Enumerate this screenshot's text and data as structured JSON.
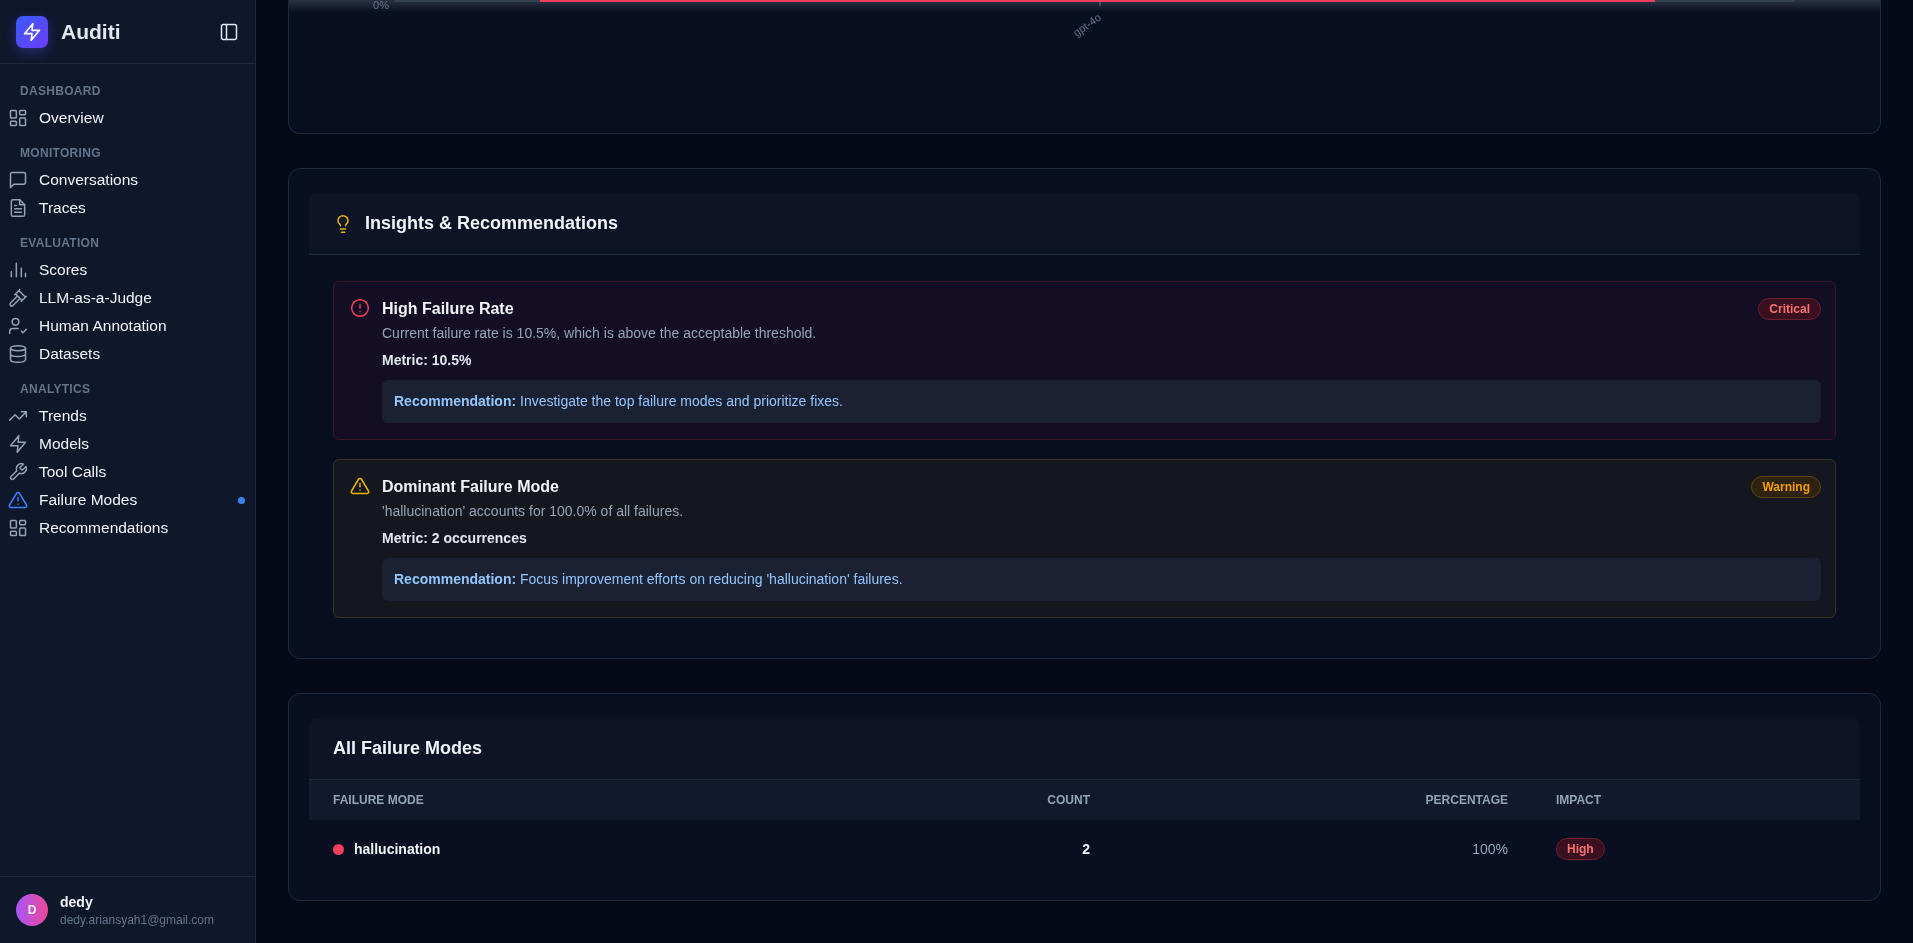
{
  "sidebar": {
    "brand": "Auditi",
    "sections": [
      {
        "label": "DASHBOARD",
        "items": [
          {
            "label": "Overview",
            "selected": false
          }
        ]
      },
      {
        "label": "MONITORING",
        "items": [
          {
            "label": "Conversations",
            "selected": false
          },
          {
            "label": "Traces",
            "selected": false
          }
        ]
      },
      {
        "label": "EVALUATION",
        "items": [
          {
            "label": "Scores",
            "selected": false
          },
          {
            "label": "LLM-as-a-Judge",
            "selected": false
          },
          {
            "label": "Human Annotation",
            "selected": false
          },
          {
            "label": "Datasets",
            "selected": false
          }
        ]
      },
      {
        "label": "ANALYTICS",
        "items": [
          {
            "label": "Trends",
            "selected": false
          },
          {
            "label": "Models",
            "selected": false
          },
          {
            "label": "Tool Calls",
            "selected": false
          },
          {
            "label": "Failure Modes",
            "selected": true
          },
          {
            "label": "Recommendations",
            "selected": false
          }
        ]
      }
    ],
    "user": {
      "initial": "D",
      "name": "dedy",
      "email": "dedy.ariansyah1@gmail.com"
    }
  },
  "chart_stub": {
    "y_tick": "0%",
    "x_label": "gpt-4o"
  },
  "insights": {
    "title": "Insights & Recommendations",
    "items": [
      {
        "kind": "critical",
        "title": "High Failure Rate",
        "description": "Current failure rate is 10.5%, which is above the acceptable threshold.",
        "metric": "Metric: 10.5%",
        "recommendation": "**Recommendation:** Investigate the top failure modes and prioritize fixes.",
        "badge": "Critical"
      },
      {
        "kind": "warning",
        "title": "Dominant Failure Mode",
        "description": "'hallucination' accounts for 100.0% of all failures.",
        "metric": "Metric: 2 occurrences",
        "recommendation": "**Recommendation:** Focus improvement efforts on reducing 'hallucination' failures.",
        "badge": "Warning"
      }
    ]
  },
  "failure_table": {
    "title": "All Failure Modes",
    "columns": [
      "FAILURE MODE",
      "COUNT",
      "PERCENTAGE",
      "IMPACT"
    ],
    "rows": [
      {
        "color": "#f43f5e",
        "mode": "hallucination",
        "count": "2",
        "percentage": "100%",
        "impact": "High"
      }
    ]
  }
}
